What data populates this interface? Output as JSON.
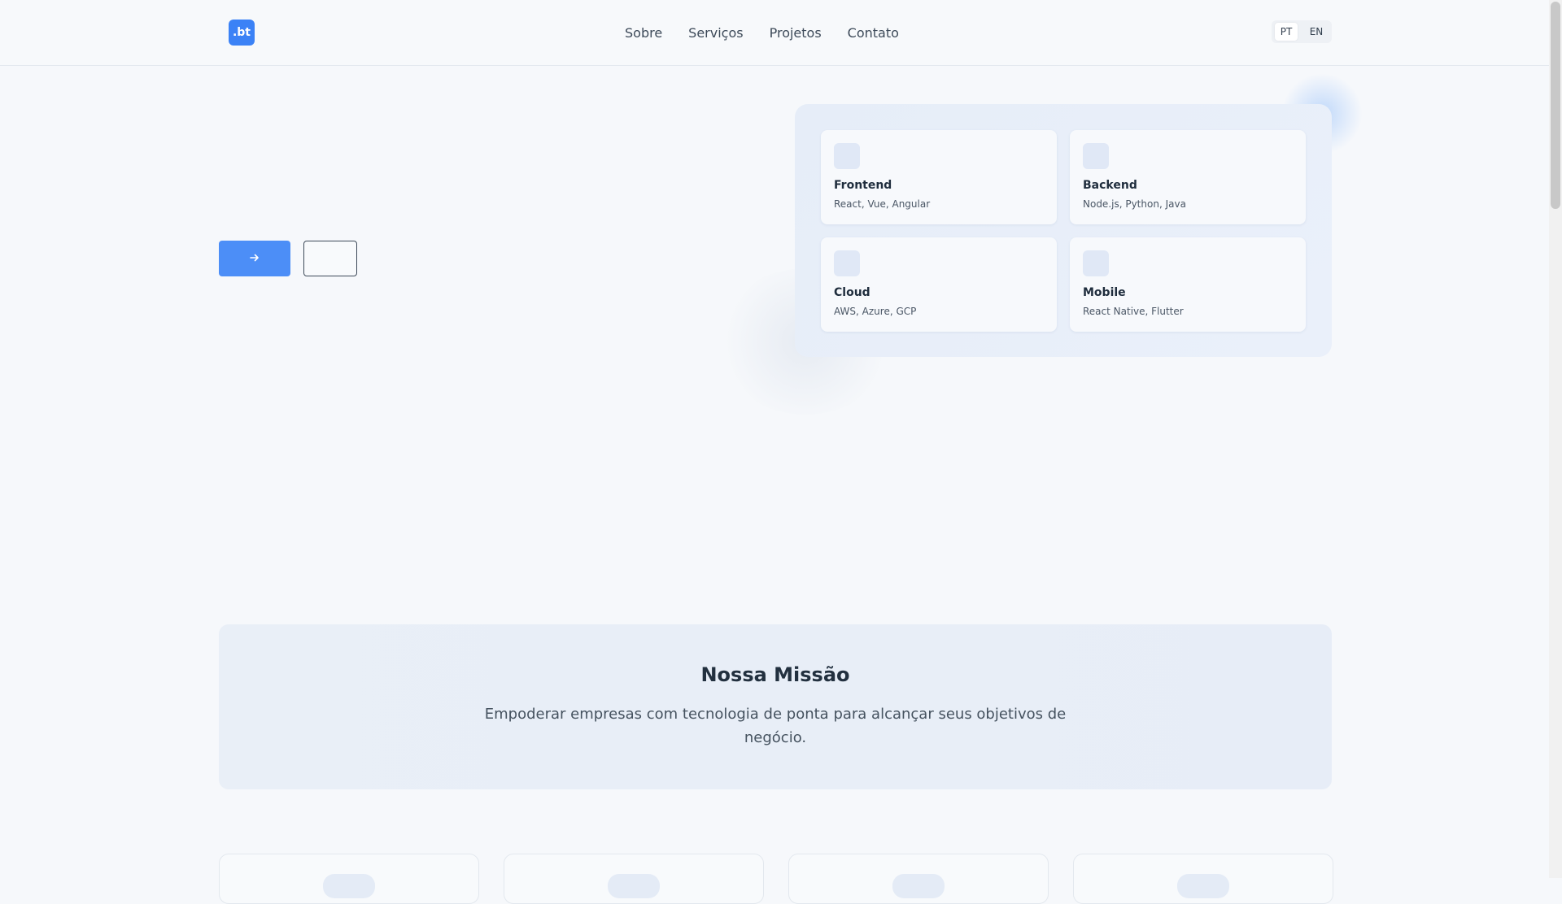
{
  "header": {
    "logo": ".bt",
    "nav": [
      "Sobre",
      "Serviços",
      "Projetos",
      "Contato"
    ],
    "languages": [
      "PT",
      "EN"
    ],
    "active_language": "PT"
  },
  "hero": {
    "primary_button_icon": "arrow-right-icon",
    "tech": [
      {
        "title": "Frontend",
        "subtitle": "React, Vue, Angular"
      },
      {
        "title": "Backend",
        "subtitle": "Node.js, Python, Java"
      },
      {
        "title": "Cloud",
        "subtitle": "AWS, Azure, GCP"
      },
      {
        "title": "Mobile",
        "subtitle": "React Native, Flutter"
      }
    ]
  },
  "mission": {
    "title": "Nossa Missão",
    "text": "Empoderar empresas com tecnologia de ponta para alcançar seus objetivos de negócio."
  },
  "colors": {
    "accent": "#3b82f6",
    "background": "#f6f8fb"
  }
}
